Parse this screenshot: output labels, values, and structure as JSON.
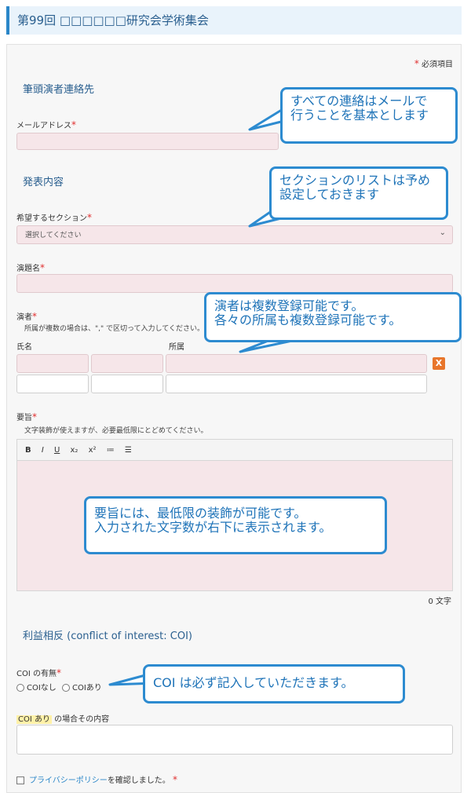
{
  "header": {
    "title": "第99回 □□□□□□研究会学術集会"
  },
  "form": {
    "required_note": "必須項目",
    "required_mark": "*",
    "sections": {
      "contact": "筆頭演者連絡先",
      "presentation": "発表内容",
      "coi": "利益相反 (conflict of interest: COI)"
    },
    "email": {
      "label": "メールアドレス",
      "value": ""
    },
    "section_select": {
      "label": "希望するセクション",
      "selected": "選択してください"
    },
    "title": {
      "label": "演題名",
      "value": ""
    },
    "presenters": {
      "label": "演者",
      "note": "所属が複数の場合は、\",\" で区切って入力してください。",
      "col_name": "氏名",
      "col_affil": "所属",
      "remove_label": "X"
    },
    "abstract": {
      "label": "要旨",
      "note": "文字装飾が使えますが、必要最低限にとどめてください。",
      "toolbar": [
        "B",
        "I",
        "U",
        "x₂",
        "x²",
        "≔",
        "☰"
      ],
      "char_count": "0 文字"
    },
    "coi_field": {
      "label": "COI の有無",
      "opt_none": "COIなし",
      "opt_yes": "COIあり",
      "detail_hl": "COI あり",
      "detail_rest": " の場合その内容"
    },
    "privacy": {
      "link": "プライバシーポリシー",
      "rest": "を確認しました。"
    }
  },
  "callouts": {
    "c1": [
      "すべての連絡はメールで",
      "行うことを基本とします"
    ],
    "c2": [
      "セクションのリストは予め",
      "設定しておきます"
    ],
    "c3": [
      "演者は複数登録可能です。",
      "各々の所属も複数登録可能です。"
    ],
    "c4": [
      "要旨には、最低限の装飾が可能です。",
      "入力された文字数が右下に表示されます。"
    ],
    "c5": [
      "COI は必ず記入していただきます。"
    ]
  },
  "colors": {
    "accent": "#2a86c8",
    "callout_border": "#2d8bd0",
    "required": "#e03030",
    "field_bg": "#f6e6e9"
  }
}
